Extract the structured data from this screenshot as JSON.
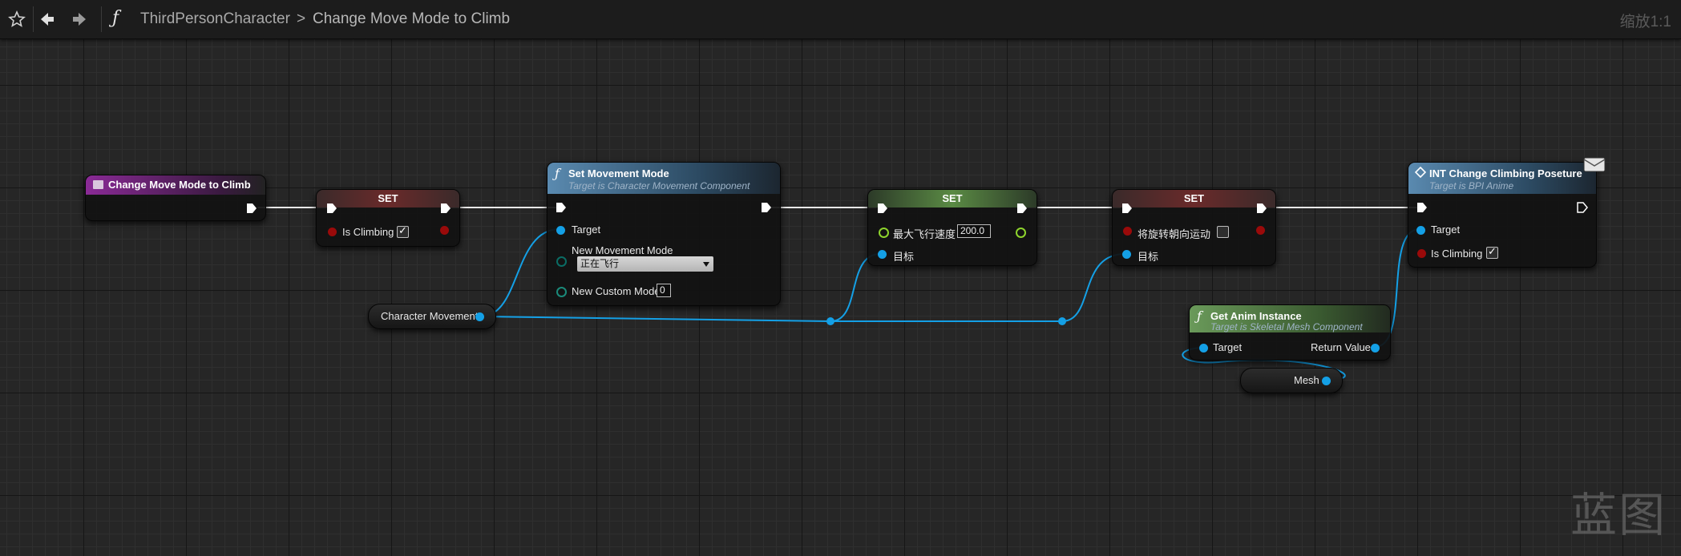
{
  "breadcrumb": {
    "blueprint": "ThirdPersonCharacter",
    "separator": ">",
    "function": "Change Move Mode to Climb",
    "function_icon": "ƒ"
  },
  "zoom": "缩放1:1",
  "watermark": "蓝图",
  "colors": {
    "exec": "#ffffff",
    "object_pin": "#14a0e6",
    "bool_pin": "#9a0a0a",
    "float_pin": "#8ed42c",
    "byte_pin": "#0a5f58",
    "int_pin": "#20d49a",
    "entry_header": "#7e2a8a",
    "function_header": "#4d7ea3",
    "set_bool_header": "#6a2222",
    "set_float_header": "#4d7a3a",
    "pure_header": "#5a7a4a"
  },
  "nodes": {
    "entry": {
      "title": "Change Move Mode to Climb"
    },
    "set_climbing": {
      "title": "SET",
      "pin_label": "Is Climbing",
      "checked": true
    },
    "set_movement_mode": {
      "title": "Set Movement Mode",
      "subtitle": "Target is Character Movement Component",
      "target_label": "Target",
      "mode_label": "New Movement Mode",
      "mode_value": "正在飞行",
      "custom_label": "New Custom Mode",
      "custom_value": "0"
    },
    "set_fly_speed": {
      "title": "SET",
      "pin_label": "最大飞行速度",
      "value": "200.0",
      "target_label": "目标"
    },
    "set_orient": {
      "title": "SET",
      "pin_label": "将旋转朝向运动",
      "checked": false,
      "target_label": "目标"
    },
    "change_pose": {
      "title": "INT Change Climbing Poseture",
      "subtitle": "Target is BPI Anime",
      "target_label": "Target",
      "climb_label": "Is Climbing",
      "checked": true
    },
    "get_anim": {
      "title": "Get Anim Instance",
      "subtitle": "Target is Skeletal Mesh Component",
      "target_label": "Target",
      "return_label": "Return Value"
    },
    "char_movement": {
      "label": "Character Movement"
    },
    "mesh": {
      "label": "Mesh"
    }
  }
}
